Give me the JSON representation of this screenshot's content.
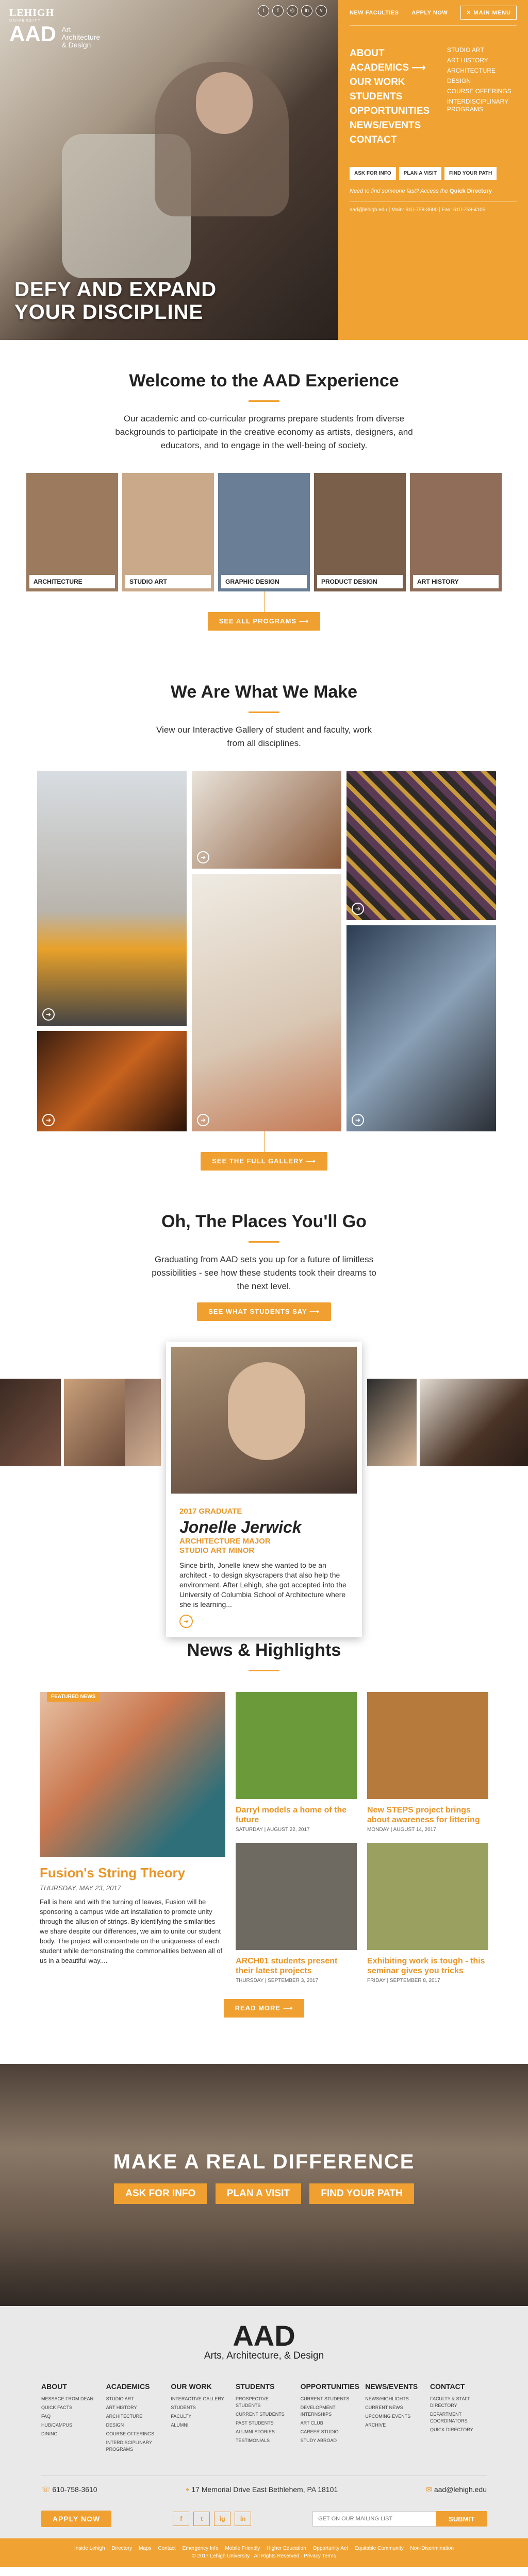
{
  "brand": {
    "lehigh": "LEHIGH",
    "university": "UNIVERSITY",
    "aad": "AAD",
    "aad_sub": [
      "Art",
      "Architecture",
      "& Design"
    ]
  },
  "social_icons": [
    "twitter-icon",
    "facebook-icon",
    "instagram-icon",
    "linkedin-icon",
    "vimeo-icon"
  ],
  "header": {
    "new_faculties": "NEW FACULTIES",
    "apply_now": "APPLY NOW",
    "main_menu": "MAIN MENU",
    "close": "✕"
  },
  "nav": {
    "main": [
      "ABOUT",
      "ACADEMICS",
      "OUR WORK",
      "STUDENTS",
      "OPPORTUNITIES",
      "NEWS/EVENTS",
      "CONTACT"
    ],
    "sub": [
      "STUDIO ART",
      "ART HISTORY",
      "ARCHITECTURE",
      "DESIGN",
      "COURSE OFFERINGS",
      "INTERDISCIPLINARY PROGRAMS"
    ]
  },
  "panel_ctas": [
    "ASK FOR INFO",
    "PLAN A VISIT",
    "FIND YOUR PATH"
  ],
  "panel_help": {
    "text": "Need to find someone fast? Access the",
    "link": "Quick Directory"
  },
  "panel_contact": "aad@lehigh.edu  |  Main: 610-758-3600  |  Fax: 610-758-4105",
  "hero_title": [
    "DEFY AND EXPAND",
    "YOUR DISCIPLINE"
  ],
  "welcome": {
    "title": "Welcome to the AAD Experience",
    "text": "Our academic and co-curricular programs prepare students from diverse backgrounds to participate in the creative economy as artists, designers, and educators, and to engage in the well-being of society.",
    "button": "SEE ALL PROGRAMS"
  },
  "programs": [
    {
      "label": "ARCHITECTURE",
      "color": "#9b7a5e"
    },
    {
      "label": "STUDIO ART",
      "color": "#c9a98a"
    },
    {
      "label": "GRAPHIC DESIGN",
      "color": "#6a7f95"
    },
    {
      "label": "PRODUCT DESIGN",
      "color": "#7a5f4b"
    },
    {
      "label": "ART HISTORY",
      "color": "#8f6d58"
    }
  ],
  "gallery": {
    "title": "We Are What We Make",
    "text": "View our Interactive Gallery of student and faculty, work from all disciplines.",
    "button": "SEE THE FULL GALLERY"
  },
  "places": {
    "title": "Oh, The Places You'll Go",
    "text": "Graduating from AAD sets you up for a future of limitless possibilities - see how these students took their dreams to the next level.",
    "button": "SEE WHAT STUDENTS SAY"
  },
  "featured_student": {
    "year": "2017 GRADUATE",
    "name": "Jonelle Jerwick",
    "major": "ARCHITECTURE MAJOR",
    "minor": "STUDIO ART MINOR",
    "bio": "Since birth, Jonelle knew she wanted to be an architect - to design skyscrapers that also help the environment. After Lehigh, she got accepted into the University of Columbia School of Architecture where she is learning..."
  },
  "news": {
    "title": "News & Highlights",
    "featured_tag": "FEATURED NEWS",
    "featured_title": "Fusion's String Theory",
    "featured_date": "THURSDAY, MAY 23, 2017",
    "featured_body": "Fall is here and with the turning of leaves, Fusion will be sponsoring a campus wide art installation to promote unity through the allusion of strings. By identifying the similarities we share despite our differences, we aim to unite our student body. The project will concentrate on the uniqueness of each student while demonstrating the commonalities between all of us in a beautiful way....",
    "items": [
      {
        "title": "Darryl models a home of the future",
        "date": "SATURDAY | AUGUST 22, 2017",
        "color": "#6a9a3a"
      },
      {
        "title": "New STEPS project brings about awareness for littering",
        "date": "MONDAY | AUGUST 14, 2017",
        "color": "#b57a3c"
      },
      {
        "title": "ARCH01 students present their latest projects",
        "date": "THURSDAY | SEPTEMBER 3, 2017",
        "color": "#6e6a62"
      },
      {
        "title": "Exhibiting work is tough - this seminar gives you tricks",
        "date": "FRIDAY | SEPTEMBER 8, 2017",
        "color": "#9aa060"
      }
    ],
    "button": "READ MORE"
  },
  "band": {
    "title": "MAKE A REAL DIFFERENCE",
    "buttons": [
      "ASK FOR INFO",
      "PLAN A VISIT",
      "FIND YOUR PATH"
    ]
  },
  "footer": {
    "aad": "AAD",
    "sub": "Arts, Architecture, & Design",
    "cols": [
      {
        "h": "ABOUT",
        "items": [
          "MESSAGE FROM DEAN",
          "QUICK FACTS",
          "FAQ",
          "HUB/CAMPUS",
          "DINING"
        ]
      },
      {
        "h": "ACADEMICS",
        "items": [
          "STUDIO ART",
          "ART HISTORY",
          "ARCHITECTURE",
          "DESIGN",
          "COURSE OFFERINGS",
          "INTERDISCIPLINARY PROGRAMS"
        ]
      },
      {
        "h": "OUR WORK",
        "items": [
          "INTERACTIVE GALLERY",
          "STUDENTS",
          "FACULTY",
          "ALUMNI"
        ]
      },
      {
        "h": "STUDENTS",
        "items": [
          "PROSPECTIVE STUDENTS",
          "CURRENT STUDENTS",
          "PAST STUDENTS",
          "ALUMNI STORIES",
          "TESTIMONIALS"
        ]
      },
      {
        "h": "OPPORTUNITIES",
        "items": [
          "CURRENT STUDENTS",
          "DEVELOPMENT INTERNSHIPS",
          "ART CLUB",
          "CAREER STUDIO",
          "STUDY ABROAD"
        ]
      },
      {
        "h": "NEWS/EVENTS",
        "items": [
          "NEWS/HIGHLIGHTS",
          "CURRENT NEWS",
          "UPCOMING EVENTS",
          "ARCHIVE"
        ]
      },
      {
        "h": "CONTACT",
        "items": [
          "FACULTY & STAFF DIRECTORY",
          "DEPARTMENT COORDINATORS",
          "QUICK DIRECTORY"
        ]
      }
    ],
    "phone": "610-758-3610",
    "address": "17 Memorial Drive East Bethlehem, PA 18101",
    "email": "aad@lehigh.edu",
    "apply": "APPLY NOW",
    "social": [
      "f",
      "t",
      "ig",
      "in"
    ],
    "mail_placeholder": "GET ON OUR MAILING LIST",
    "submit": "SUBMIT"
  },
  "legal": {
    "links": [
      "Inside Lehigh",
      "Directory",
      "Maps",
      "Contact",
      "Emergency Info",
      "Mobile Friendly",
      "Higher Education",
      "Opportunity Act",
      "Equitable Community",
      "Non-Discrimination"
    ],
    "copyright": "© 2017 Lehigh University · All Rights Reserved · Privacy Terms"
  }
}
